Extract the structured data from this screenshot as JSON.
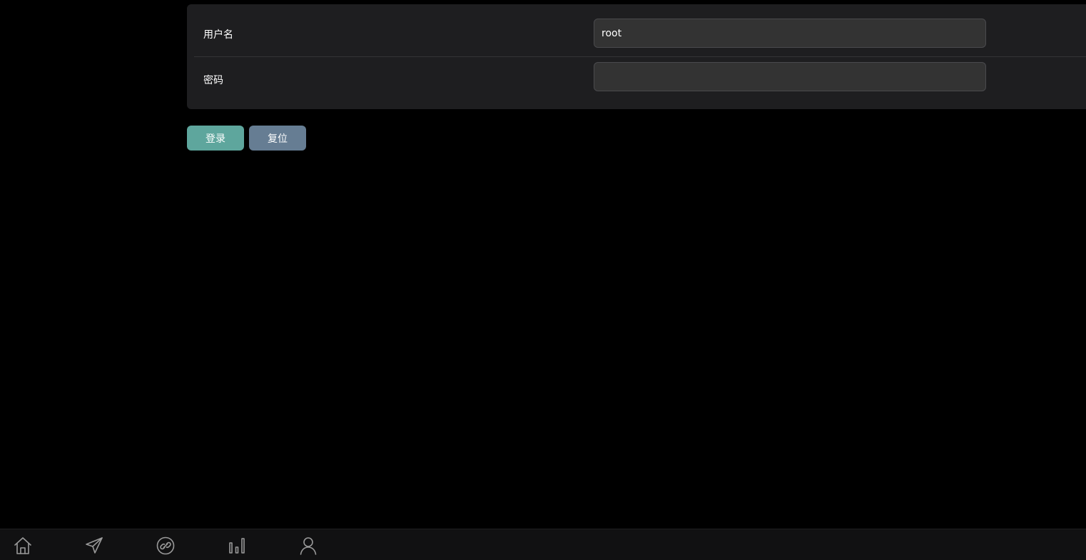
{
  "form": {
    "username_label": "用户名",
    "username_value": "root",
    "password_label": "密码",
    "password_value": ""
  },
  "actions": {
    "login_label": "登录",
    "reset_label": "复位"
  },
  "nav": {
    "items": [
      {
        "icon": "home-icon"
      },
      {
        "icon": "send-icon"
      },
      {
        "icon": "link-icon"
      },
      {
        "icon": "bar-chart-icon"
      },
      {
        "icon": "user-icon"
      }
    ]
  },
  "colors": {
    "background": "#000000",
    "card": "#1e1e20",
    "input": "#333333",
    "login_button": "#5ea69d",
    "reset_button": "#667d93",
    "bottom_bar": "#111112",
    "icon": "#9a9a9a"
  }
}
